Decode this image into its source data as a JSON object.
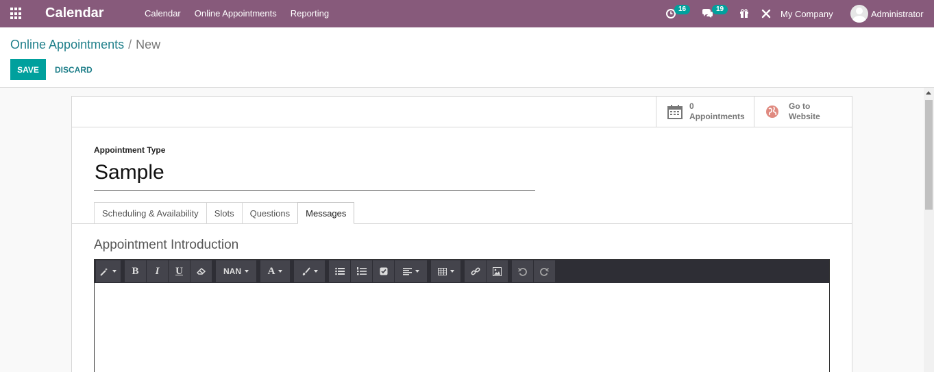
{
  "navbar": {
    "brand": "Calendar",
    "menu": [
      "Calendar",
      "Online Appointments",
      "Reporting"
    ],
    "activity_count": "16",
    "messages_count": "19",
    "company": "My Company",
    "user": "Administrator"
  },
  "control_panel": {
    "breadcrumb_parent": "Online Appointments",
    "breadcrumb_separator": "/",
    "breadcrumb_current": "New",
    "save_label": "SAVE",
    "discard_label": "DISCARD"
  },
  "button_box": {
    "appointments_count": "0",
    "appointments_label": "Appointments",
    "website_line1": "Go to",
    "website_line2": "Website"
  },
  "form": {
    "field_label": "Appointment Type",
    "name_value": "Sample",
    "tabs": [
      "Scheduling & Availability",
      "Slots",
      "Questions",
      "Messages"
    ],
    "active_tab": "Messages",
    "section_title": "Appointment Introduction"
  },
  "editor": {
    "font_size_label": "NAN",
    "font_color_label": "A",
    "bold": "B",
    "italic": "I",
    "underline": "U"
  },
  "colors": {
    "navbar": "#875a7b",
    "primary": "#00a09d",
    "link": "#1f7f8a"
  }
}
